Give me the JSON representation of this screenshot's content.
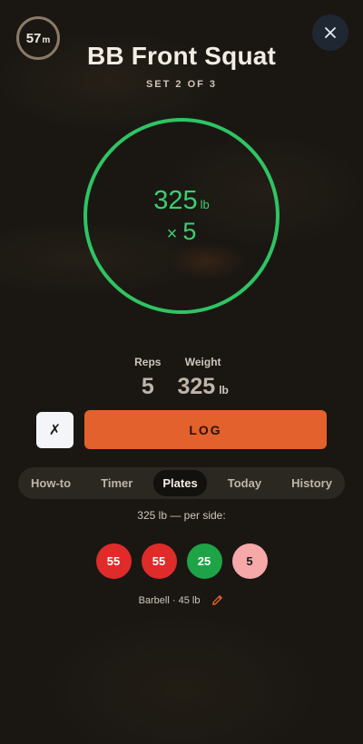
{
  "timer": {
    "value": "57",
    "unit": "m"
  },
  "exercise": {
    "title": "BB Front Squat",
    "set_label": "SET 2 OF 3"
  },
  "target": {
    "weight": "325",
    "weight_unit": "lb",
    "reps_prefix": "×",
    "reps": "5"
  },
  "stats": {
    "reps_label": "Reps",
    "reps_value": "5",
    "weight_label": "Weight",
    "weight_value": "325",
    "weight_unit": "lb"
  },
  "actions": {
    "cancel_label": "✗",
    "log_label": "LOG"
  },
  "tabs": [
    {
      "label": "How-to"
    },
    {
      "label": "Timer"
    },
    {
      "label": "Plates"
    },
    {
      "label": "Today"
    },
    {
      "label": "History"
    }
  ],
  "active_tab": "Plates",
  "plates_panel": {
    "per_side_text": "325 lb — per side:",
    "plates": [
      {
        "value": "55",
        "color": "#e02b2b",
        "text_color": "#ffffff"
      },
      {
        "value": "55",
        "color": "#e02b2b",
        "text_color": "#ffffff"
      },
      {
        "value": "25",
        "color": "#1ea446",
        "text_color": "#ffffff"
      },
      {
        "value": "5",
        "color": "#f7a8a8",
        "text_color": "#1a1a1a"
      }
    ],
    "barbell_text": "Barbell · 45 lb"
  },
  "colors": {
    "accent": "#e2612d",
    "ring": "#2fc463",
    "background": "#1a1713"
  },
  "icons": {
    "close": "close-icon",
    "edit": "pencil-icon"
  }
}
